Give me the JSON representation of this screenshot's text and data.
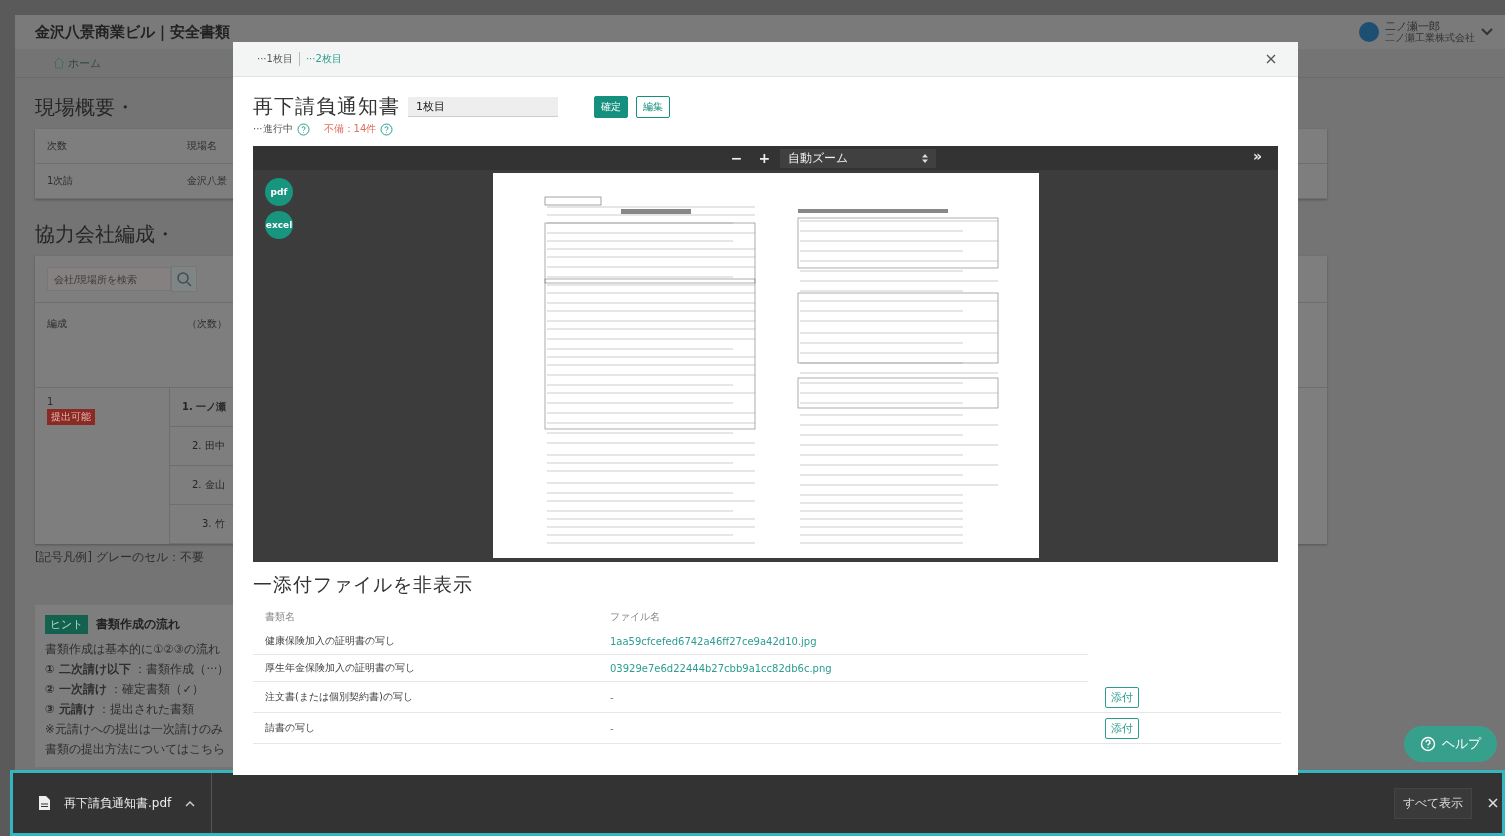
{
  "header": {
    "title": "金沢八景商業ビル｜安全書類",
    "user_name": "二ノ瀬一郎",
    "company": "二ノ瀬工業株式会社"
  },
  "breadcrumb": {
    "home": "ホーム"
  },
  "site_overview": {
    "heading": "現場概要・",
    "columns": [
      "次数",
      "現場名"
    ],
    "rows": [
      [
        "1次請",
        "金沢八景"
      ]
    ]
  },
  "partners": {
    "heading": "協力会社編成・",
    "search": {
      "placeholder": "会社/現場所を検索"
    },
    "columns": [
      "編成",
      "（次数）"
    ],
    "group": {
      "number": "1",
      "badge": "提出可能"
    },
    "companies": [
      {
        "label": "1. 一ノ瀬",
        "children": [
          {
            "label": "2. 田中"
          },
          {
            "label": "2. 金山",
            "children": [
              {
                "label": "3. 竹"
              }
            ]
          }
        ]
      }
    ],
    "legend": "[記号凡例] グレーのセル：不要"
  },
  "hint": {
    "badge": "ヒント",
    "title": "書類作成の流れ",
    "lines": [
      "書類作成は基本的に①②③の流れ",
      "**① 二次請け以下** ：書類作成（···）",
      "**② 一次請け** ：確定書類（✓）",
      "**③ 元請け** ：提出された書類",
      "※元請けへの提出は一次請けのみ",
      "書類の提出方法についてはこちら"
    ]
  },
  "modal": {
    "tabs": [
      {
        "label": "···1枚目",
        "selected": true
      },
      {
        "label": "···2枚目",
        "selected": false
      }
    ],
    "title": "再下請負通知書",
    "sheet_field": {
      "value": "1枚目"
    },
    "buttons": [
      {
        "label": "確定",
        "kind": "primary"
      },
      {
        "label": "編集",
        "kind": "outline"
      }
    ],
    "status": "···進行中",
    "defects": "不備：14件",
    "viewer": {
      "zoom_out": "−",
      "zoom_in": "+",
      "zoom": "自動ズーム",
      "expand": "»",
      "side_buttons": [
        "pdf",
        "excel"
      ]
    },
    "attachments": {
      "toggle": "一添付ファイルを非表示",
      "columns": [
        "書類名",
        "ファイル名"
      ],
      "rows": [
        {
          "name": "健康保険加入の証明書の写し",
          "file": "1aa59cfcefed6742a46ff27ce9a42d10.jpg",
          "kind": "file"
        },
        {
          "name": "厚生年金保険加入の証明書の写し",
          "file": "03929e7e6d22444b27cbb9a1cc82db6c.png",
          "kind": "file"
        },
        {
          "name": "注文書(または個別契約書)の写し",
          "file": "-",
          "kind": "empty",
          "button": "添付"
        },
        {
          "name": "請書の写し",
          "file": "-",
          "kind": "empty",
          "button": "添付"
        }
      ]
    }
  },
  "help": "ヘルプ",
  "download": {
    "file": "再下請負通知書.pdf",
    "show_all": "すべて表示"
  }
}
